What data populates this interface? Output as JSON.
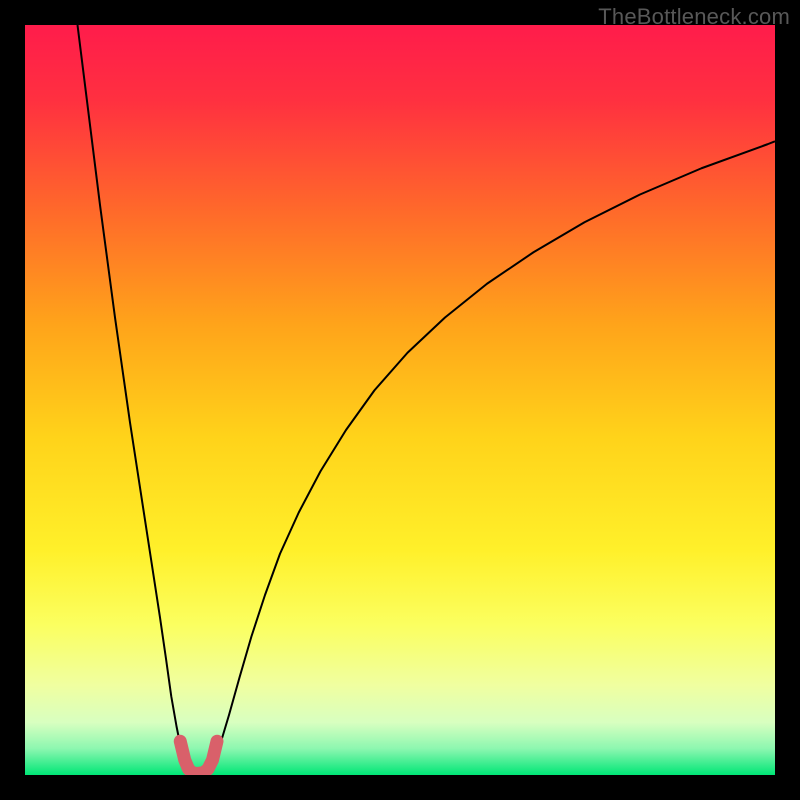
{
  "watermark": "TheBottleneck.com",
  "chart_data": {
    "type": "line",
    "title": "",
    "xlabel": "",
    "ylabel": "",
    "xlim": [
      0,
      100
    ],
    "ylim": [
      0,
      100
    ],
    "grid": false,
    "background_gradient": {
      "stops": [
        {
          "offset": 0.0,
          "color": "#ff1c4b"
        },
        {
          "offset": 0.1,
          "color": "#ff3040"
        },
        {
          "offset": 0.25,
          "color": "#ff6a2a"
        },
        {
          "offset": 0.4,
          "color": "#ffa41a"
        },
        {
          "offset": 0.55,
          "color": "#ffd31a"
        },
        {
          "offset": 0.7,
          "color": "#fff02a"
        },
        {
          "offset": 0.8,
          "color": "#fbff60"
        },
        {
          "offset": 0.88,
          "color": "#f0ffa0"
        },
        {
          "offset": 0.93,
          "color": "#d8ffc0"
        },
        {
          "offset": 0.965,
          "color": "#8cf7b0"
        },
        {
          "offset": 1.0,
          "color": "#00e676"
        }
      ]
    },
    "series": [
      {
        "name": "curve-left",
        "stroke": "#000000",
        "stroke_width": 2,
        "x": [
          7.0,
          8.0,
          9.0,
          10.0,
          11.0,
          12.0,
          13.0,
          14.0,
          15.0,
          16.0,
          17.0,
          18.0,
          18.8,
          19.5,
          20.2,
          20.8,
          21.3
        ],
        "y": [
          100.0,
          92.0,
          84.0,
          76.0,
          68.5,
          61.0,
          54.0,
          47.0,
          40.5,
          34.0,
          27.5,
          21.0,
          15.5,
          10.5,
          6.5,
          3.5,
          1.5
        ]
      },
      {
        "name": "curve-right",
        "stroke": "#000000",
        "stroke_width": 2,
        "x": [
          25.0,
          26.0,
          27.2,
          28.6,
          30.2,
          32.0,
          34.0,
          36.5,
          39.4,
          42.8,
          46.6,
          51.0,
          56.0,
          61.6,
          67.8,
          74.6,
          82.0,
          90.2,
          99.0,
          100.0
        ],
        "y": [
          1.5,
          4.0,
          8.0,
          13.0,
          18.5,
          24.0,
          29.5,
          35.0,
          40.5,
          46.0,
          51.3,
          56.3,
          61.0,
          65.5,
          69.7,
          73.7,
          77.4,
          80.9,
          84.1,
          84.5
        ]
      },
      {
        "name": "dip-marker",
        "stroke": "#d9606a",
        "stroke_width": 13,
        "linecap": "round",
        "x": [
          20.7,
          21.3,
          21.8,
          22.3,
          23.0,
          23.8,
          24.4,
          25.0,
          25.6
        ],
        "y": [
          4.5,
          2.0,
          0.8,
          0.3,
          0.2,
          0.3,
          0.8,
          2.0,
          4.5
        ]
      }
    ]
  }
}
